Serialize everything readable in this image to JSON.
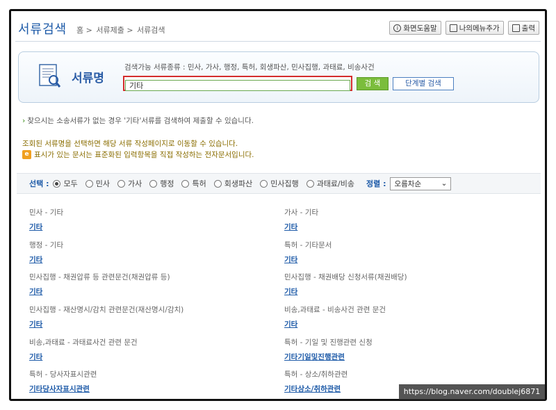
{
  "header": {
    "title": "서류검색",
    "breadcrumb": [
      "홈 >",
      "서류제출 >",
      "서류검색"
    ],
    "help_button": "화면도움말",
    "my_menu_button": "나의메뉴추가",
    "print_button": "출력"
  },
  "search": {
    "doc_label": "서류명",
    "available_types": "검색가능 서류종류 : 민사, 가사, 행정, 특허, 회생파산, 민사집행, 과태료, 비송사건",
    "input_value": "기타",
    "search_button": "검 색",
    "step_search_button": "단계별 검색"
  },
  "notices": {
    "not_found": "찾으시는 소송서류가 없는 경우 '기타'서류를 검색하여 제출할 수 있습니다.",
    "select_hint": "조회된 서류명을 선택하면 해당 서류 작성페이지로 이동할 수 있습니다.",
    "e_doc_hint": "표시가 있는 문서는 표준화된 입력항목을 직접 작성하는 전자문서입니다.",
    "e_icon": "e"
  },
  "filter": {
    "label": "선택 :",
    "options": [
      "모두",
      "민사",
      "가사",
      "행정",
      "특허",
      "회생파산",
      "민사집행",
      "과태료/비송"
    ],
    "selected": "모두",
    "sort_label": "정렬 :",
    "sort_value": "오름차순"
  },
  "results": [
    {
      "category": "민사 - 기타",
      "link": "기타"
    },
    {
      "category": "가사 - 기타",
      "link": "기타"
    },
    {
      "category": "행정 - 기타",
      "link": "기타"
    },
    {
      "category": "특허 - 기타문서",
      "link": "기타"
    },
    {
      "category": "민사집행 - 채권압류 등 관련문건(채권압류 등)",
      "link": "기타"
    },
    {
      "category": "민사집행 - 채권배당 신청서류(채권배당)",
      "link": "기타"
    },
    {
      "category": "민사집행 - 재산명시/감치 관련문건(재산명시/감치)",
      "link": "기타"
    },
    {
      "category": "비송,과태료 - 비송사건 관련 문건",
      "link": "기타"
    },
    {
      "category": "비송,과태료 - 과태료사건 관련 문건",
      "link": "기타"
    },
    {
      "category": "특허 - 기일 및 진행관련 신청",
      "link": "기타기일및진행관련"
    },
    {
      "category": "특허 - 당사자표시관련",
      "link": "기타당사자표시관련"
    },
    {
      "category": "특허 - 상소/취하관련",
      "link": "기타상소/취하관련"
    }
  ],
  "watermark": "https://blog.naver.com/doublej6871"
}
